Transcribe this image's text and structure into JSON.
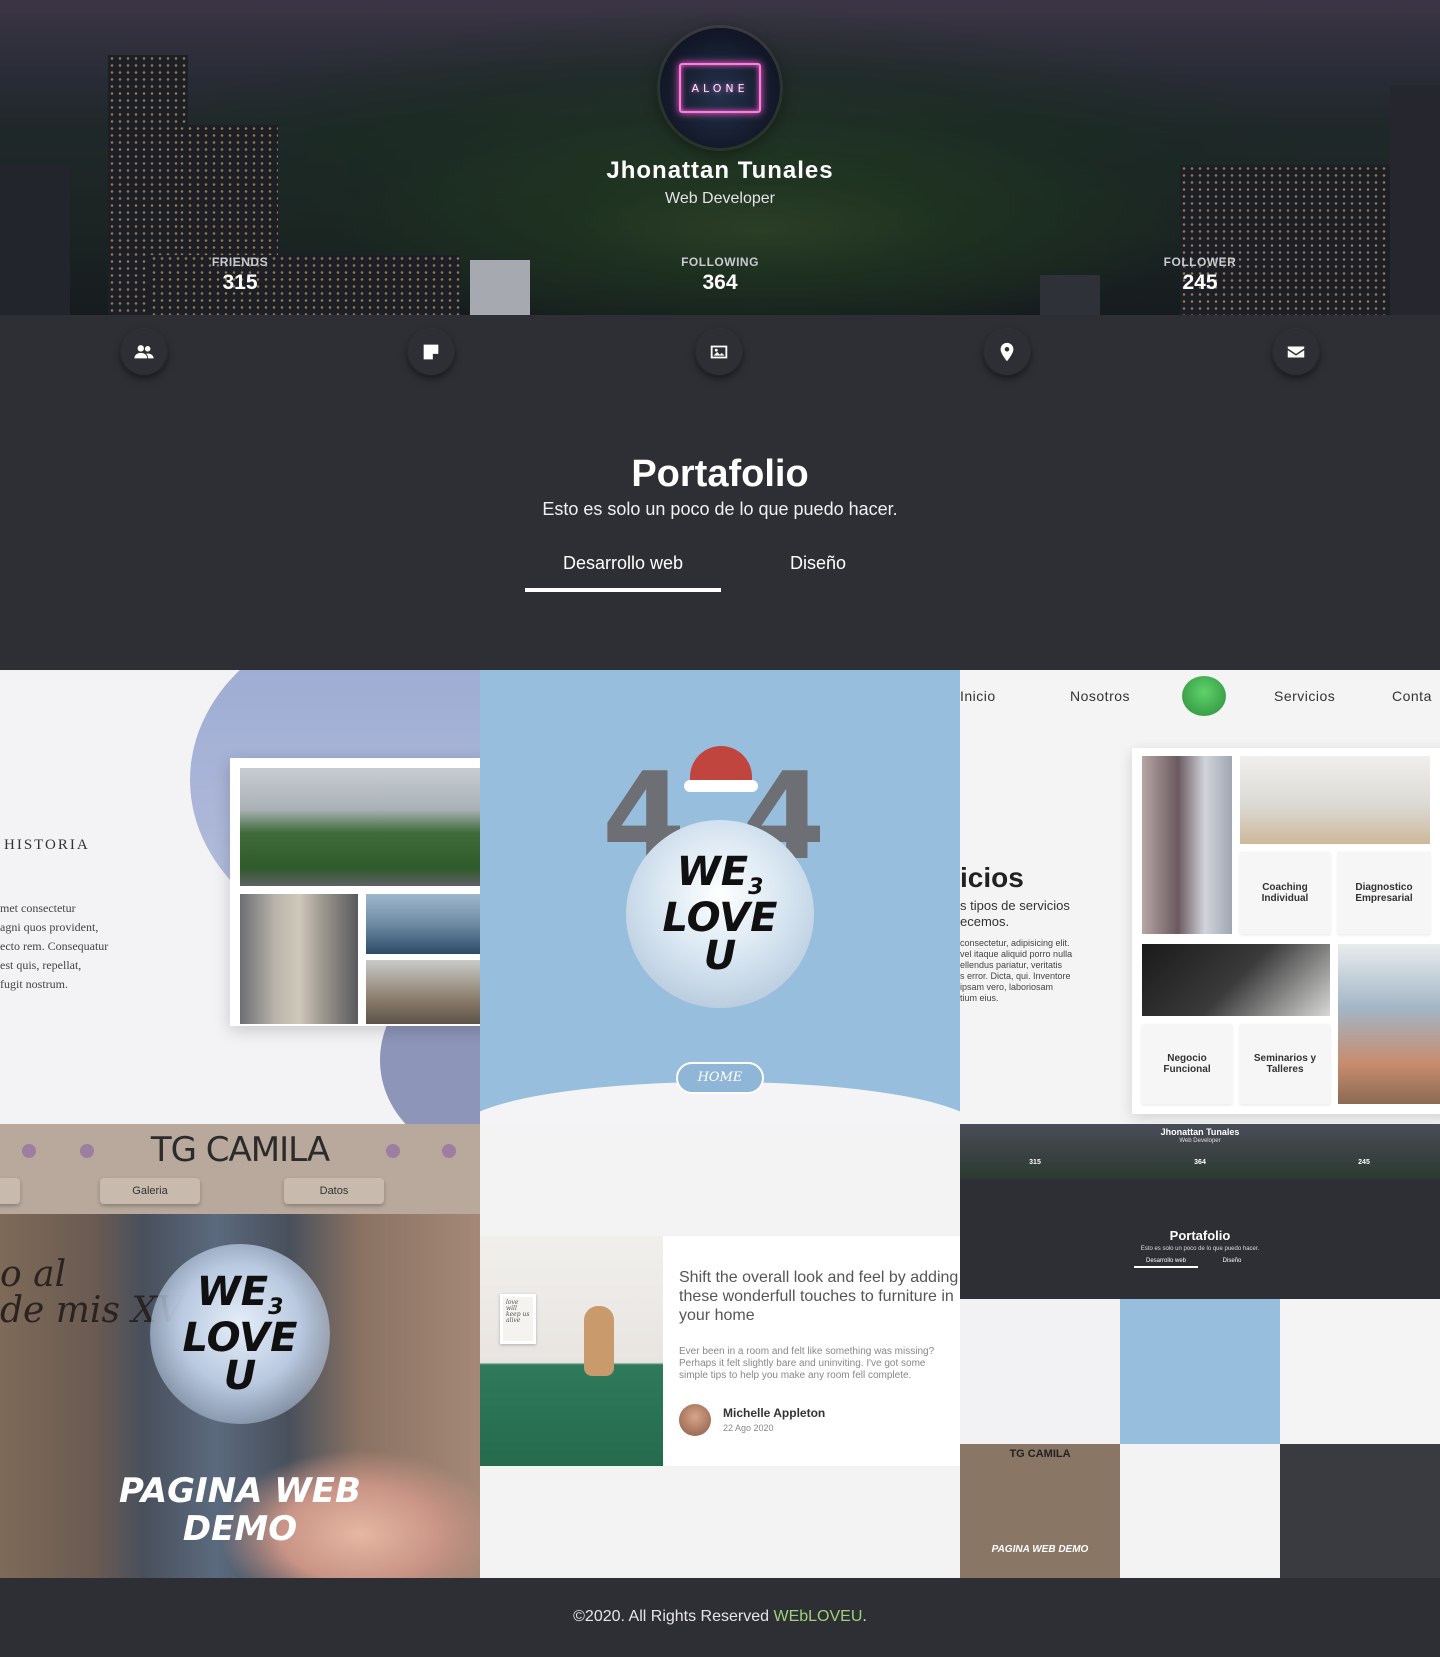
{
  "profile": {
    "avatar_sign": "ALONE",
    "name": "Jhonattan Tunales",
    "role": "Web Developer",
    "stats": [
      {
        "label": "FRIENDS",
        "value": "315"
      },
      {
        "label": "FOLLOWING",
        "value": "364"
      },
      {
        "label": "FOLLOWER",
        "value": "245"
      }
    ]
  },
  "iconbar": [
    "users-icon",
    "note-icon",
    "image-icon",
    "location-pin-icon",
    "envelope-icon"
  ],
  "portfolio": {
    "title": "Portafolio",
    "subtitle": "Esto es solo un poco de lo que puedo hacer.",
    "tabs": [
      {
        "label": "Desarrollo web",
        "active": true
      },
      {
        "label": "Diseño",
        "active": false
      }
    ]
  },
  "projects": {
    "historia": {
      "heading": "HISTORIA",
      "text": "met consectetur\nagni quos provident,\necto rem. Consequatur\nest quis, repellat,\nfugit nostrum."
    },
    "p404": {
      "digit_left": "4",
      "digit_right": "4",
      "logo_line1": "WE",
      "logo_sub": "3",
      "logo_line2": "LOVE",
      "logo_line3": "U",
      "button": "HOME"
    },
    "servicios": {
      "nav": [
        "Inicio",
        "Nosotros",
        "Servicios",
        "Conta"
      ],
      "heading": "icios",
      "subtitle": "s tipos de servicios\necemos.",
      "paragraph": "consectetur, adipisicing elit.\nvel itaque aliquid porro nulla\nellendus pariatur, veritatis\ns error. Dicta, qui. Inventore\nipsam vero, laboriosam\ntium eius.",
      "tiles": [
        "Coaching\nIndividual",
        "Diagnostico\nEmpresarial",
        "Negocio\nFuncional",
        "Seminarios y\nTalleres"
      ]
    },
    "camila": {
      "brand": "TG CAMILA",
      "tabs": [
        "Galeria",
        "Datos"
      ],
      "script_line1": "o al",
      "script_line2": "de mis XV",
      "logo_line1": "WE",
      "logo_sub": "3",
      "logo_line2": "LOVE",
      "logo_line3": "U",
      "demo": "PAGINA WEB\nDEMO"
    },
    "furniture": {
      "title": "Shift the overall look and feel by adding these wonderfull touches to furniture in your home",
      "desc": "Ever been in a room and felt like something was missing? Perhaps it felt slightly bare and uninviting. I've got some simple tips to help you make any room fell complete.",
      "author": "Michelle Appleton",
      "date": "22 Ago 2020",
      "frame_text": "love\nwill\nkeep us\nalive"
    },
    "mini": {
      "name": "Jhonattan Tunales",
      "role": "Web Developer",
      "stats": [
        {
          "label": "FRIENDS",
          "value": "315"
        },
        {
          "label": "FOLLOWING",
          "value": "364"
        },
        {
          "label": "FOLLOWER",
          "value": "245"
        }
      ],
      "title": "Portafolio",
      "subtitle": "Esto es solo un poco de lo que puedo hacer.",
      "tab1": "Desarrollo web",
      "tab2": "Diseño",
      "thumb_brand": "TG CAMILA",
      "thumb_demo": "PAGINA WEB DEMO"
    }
  },
  "footer": {
    "text": "©2020. All Rights Reserved ",
    "brand": "WEbLOVEU",
    "end": "."
  }
}
